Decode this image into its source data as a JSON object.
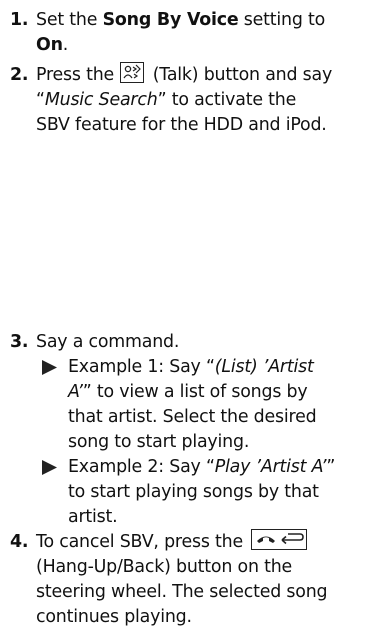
{
  "step1": {
    "num": "1.",
    "t1": "Set the ",
    "setting": "Song By Voice",
    "t2": " setting to",
    "value": "On",
    "t3": "."
  },
  "step2": {
    "num": "2.",
    "t1": "Press the ",
    "icon": "talk-button-icon",
    "t2": " (Talk) button and say",
    "q1": "“",
    "phrase": "Music Search",
    "q2": "” to activate the",
    "line3": "SBV feature for the HDD and iPod."
  },
  "step3": {
    "num": "3.",
    "text": "Say a command.",
    "ex1": {
      "a": "Example 1: Say “",
      "b": "(List) ’Artist",
      "c": "A’",
      "d": "” to view a list of songs by",
      "e": "that artist. Select the desired",
      "f": "song to start playing."
    },
    "ex2": {
      "a": "Example 2: Say “",
      "b": "Play ’Artist A’",
      "c": "”",
      "d": "to start playing songs by that",
      "e": "artist."
    }
  },
  "step4": {
    "num": "4.",
    "t1": "To cancel SBV, press the ",
    "icon": "hang-up-back-button-icon",
    "line2": "(Hang-Up/Back) button on the",
    "line3": "steering wheel. The selected song",
    "line4": "continues playing."
  }
}
